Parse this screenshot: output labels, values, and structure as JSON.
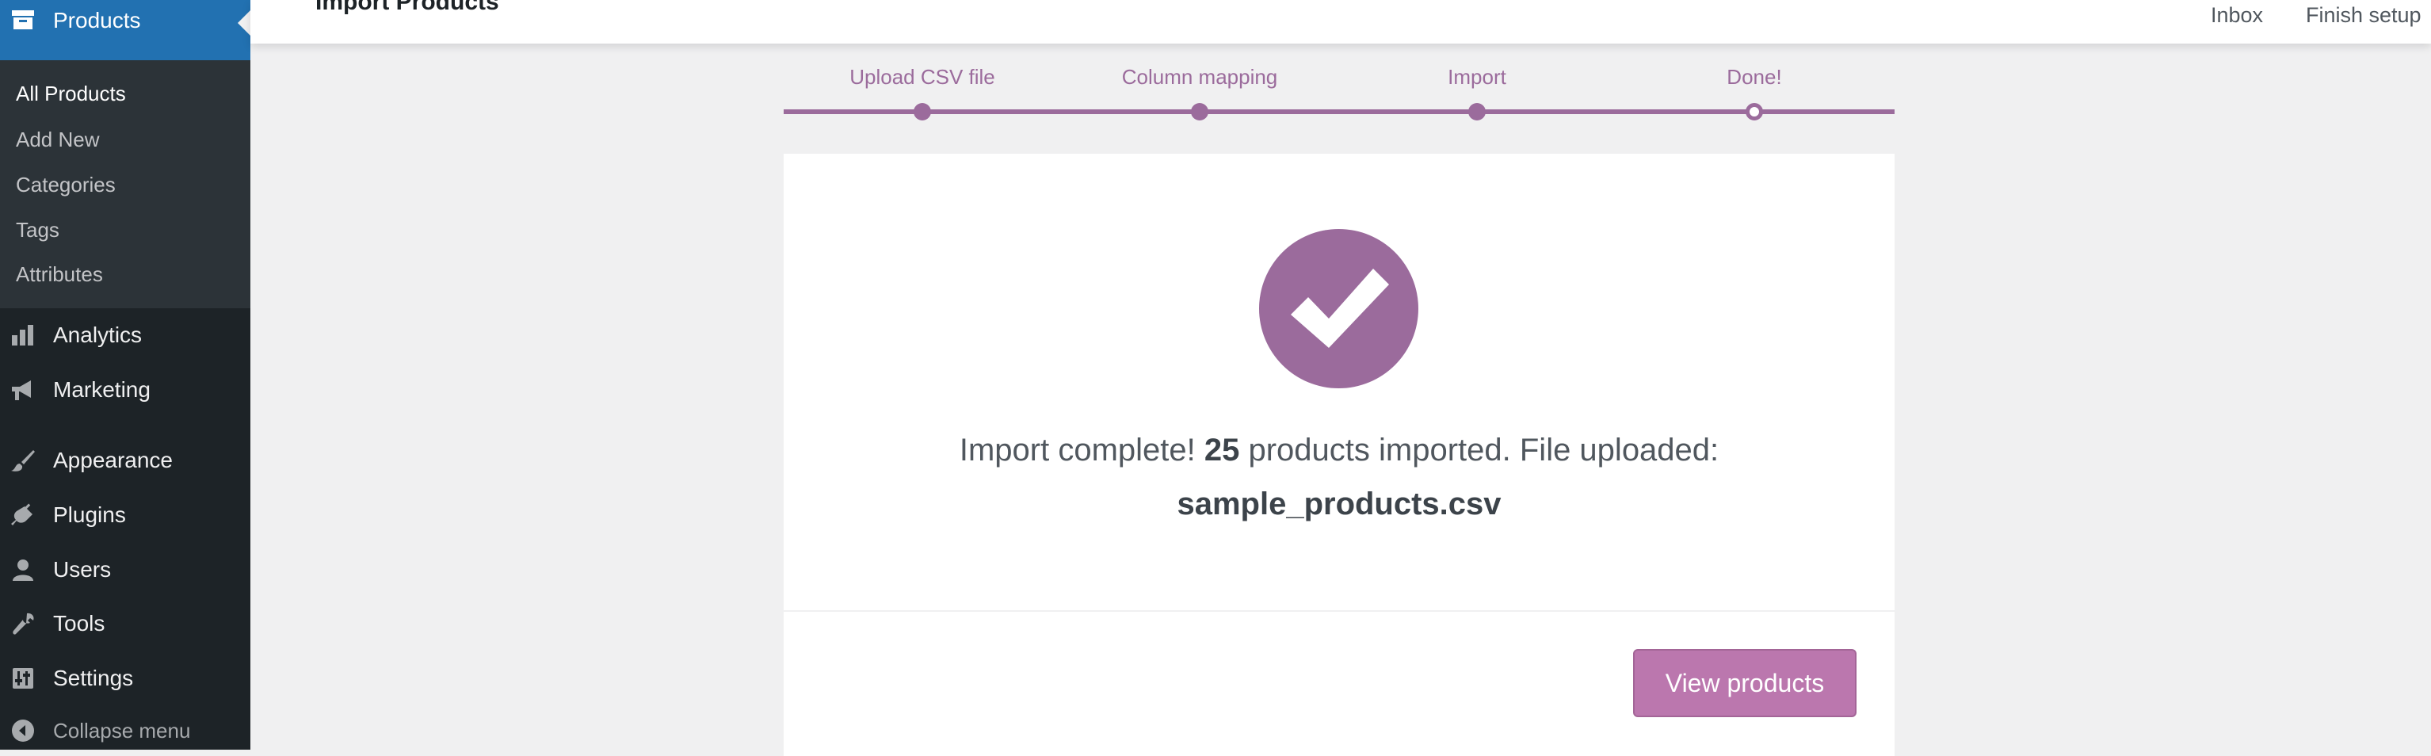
{
  "sidebar": {
    "current": {
      "label": "Products",
      "icon": "products-archive-icon"
    },
    "submenu": [
      "All Products",
      "Add New",
      "Categories",
      "Tags",
      "Attributes"
    ],
    "items": [
      {
        "label": "Analytics",
        "icon": "bar-chart-icon"
      },
      {
        "label": "Marketing",
        "icon": "megaphone-icon"
      },
      {
        "label": "Appearance",
        "icon": "paintbrush-icon"
      },
      {
        "label": "Plugins",
        "icon": "plug-icon"
      },
      {
        "label": "Users",
        "icon": "user-icon"
      },
      {
        "label": "Tools",
        "icon": "wrench-icon"
      },
      {
        "label": "Settings",
        "icon": "settings-sliders-icon"
      }
    ],
    "collapse_label": "Collapse menu"
  },
  "topbar": {
    "title": "Import Products",
    "inbox": "Inbox",
    "finish_setup": "Finish setup"
  },
  "steps": [
    "Upload CSV file",
    "Column mapping",
    "Import",
    "Done!"
  ],
  "result": {
    "prefix": "Import complete!",
    "count": "25",
    "middle": "products imported. File uploaded:",
    "filename": "sample_products.csv"
  },
  "view_products_label": "View products",
  "colors": {
    "accent": "#9b6b9c",
    "button": "#bb77ae",
    "sidebar": "#1d2327",
    "current": "#2271b1"
  }
}
